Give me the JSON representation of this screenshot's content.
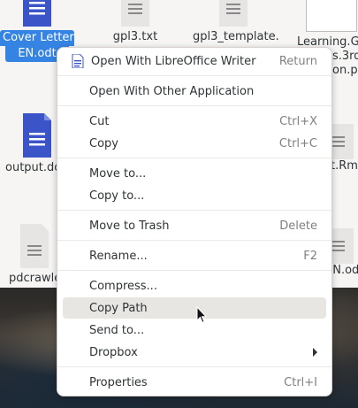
{
  "files": [
    {
      "name": "Cover Letter EN.odt",
      "line1": "Cover Letter",
      "line2": "EN.odt",
      "selected": true,
      "icon": "writer-doc-icon"
    },
    {
      "name": "gpl3.txt",
      "line1": "gpl3.txt",
      "line2": "",
      "icon": "text-file-icon"
    },
    {
      "name": "gpl3_template.",
      "line1": "gpl3_template.",
      "line2": "",
      "icon": "text-file-icon"
    },
    {
      "name": "Learning.GN",
      "line1": "Learning.GN",
      "line2": "s.3rd",
      "line3": "on.pd",
      "icon": "pdf-file-icon"
    },
    {
      "name": "output.do",
      "line1": "output.do",
      "line2": "",
      "icon": "writer-doc-icon"
    },
    {
      "name": "t.Rm",
      "line1": "t.Rm",
      "line2": "",
      "icon": "text-file-icon"
    },
    {
      "name": "pdcrawle",
      "line1": "pdcrawle",
      "line2": "",
      "icon": "text-file-icon"
    },
    {
      "name": "EN.od",
      "line1": "EN.od",
      "line2": "",
      "icon": "text-file-icon"
    }
  ],
  "menu": {
    "items": [
      {
        "label": "Open With LibreOffice Writer",
        "accel": "Return",
        "icon": "libreoffice-writer-icon"
      },
      {
        "label": "Open With Other Application",
        "accel": ""
      },
      {
        "label": "Cut",
        "accel": "Ctrl+X"
      },
      {
        "label": "Copy",
        "accel": "Ctrl+C"
      },
      {
        "label": "Move to...",
        "accel": ""
      },
      {
        "label": "Copy to...",
        "accel": ""
      },
      {
        "label": "Move to Trash",
        "accel": "Delete"
      },
      {
        "label": "Rename...",
        "accel": "F2"
      },
      {
        "label": "Compress...",
        "accel": ""
      },
      {
        "label": "Copy Path",
        "accel": "",
        "hovered": true
      },
      {
        "label": "Send to...",
        "accel": ""
      },
      {
        "label": "Dropbox",
        "accel": "",
        "submenu": true
      },
      {
        "label": "Properties",
        "accel": "Ctrl+I"
      }
    ]
  },
  "colors": {
    "accent": "#3584e4",
    "writer_blue": "#3b55c9",
    "hover": "#e8e6e3"
  }
}
